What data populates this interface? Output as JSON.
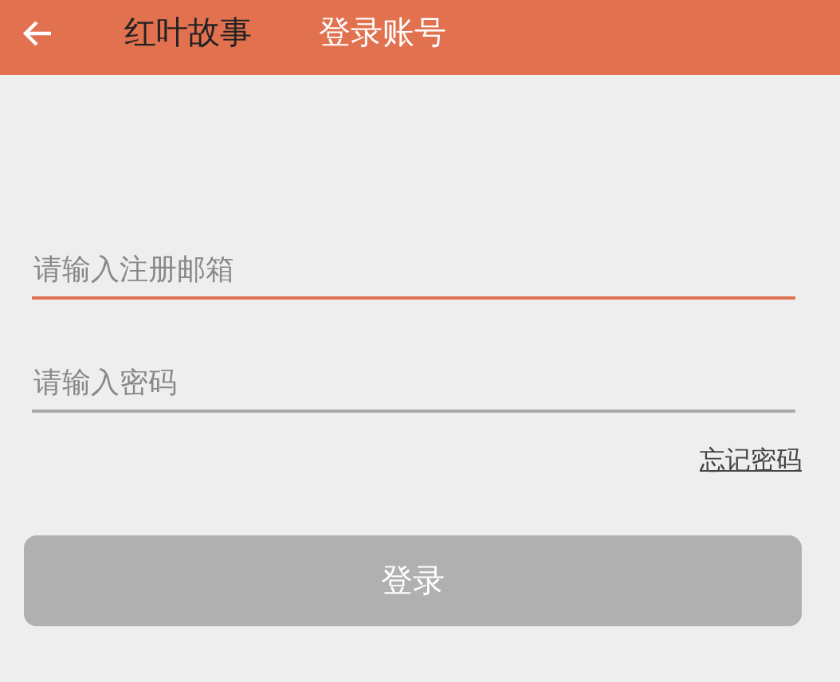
{
  "header": {
    "app_name": "红叶故事",
    "title": "登录账号"
  },
  "fields": [
    {
      "placeholder": "请输入注册邮箱",
      "focused": true
    },
    {
      "placeholder": "请输入密码",
      "focused": false
    }
  ],
  "forgot_link": "忘记密码",
  "login_button": {
    "label": "登录",
    "disabled": true
  }
}
